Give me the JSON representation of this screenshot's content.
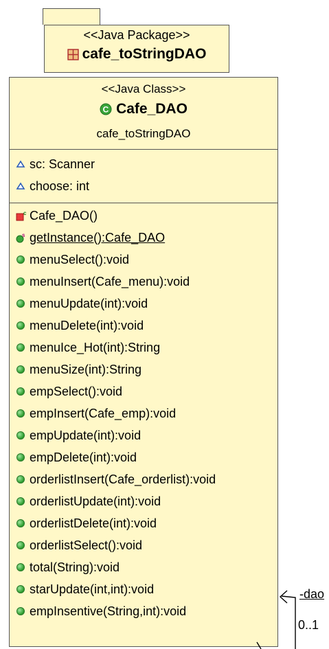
{
  "package": {
    "stereotype": "<<Java Package>>",
    "name": "cafe_toStringDAO",
    "icon": "package-icon"
  },
  "class": {
    "stereotype": "<<Java Class>>",
    "name": "Cafe_DAO",
    "package_label": "cafe_toStringDAO",
    "icon": "class-icon",
    "attributes": [
      {
        "text": "sc: Scanner",
        "icon": "package-visibility-icon"
      },
      {
        "text": "choose: int",
        "icon": "package-visibility-icon"
      }
    ],
    "operations": [
      {
        "text": "Cafe_DAO()",
        "icon": "constructor-icon"
      },
      {
        "text": "getInstance():Cafe_DAO",
        "icon": "static-method-icon"
      },
      {
        "text": "menuSelect():void",
        "icon": "public-method-icon"
      },
      {
        "text": "menuInsert(Cafe_menu):void",
        "icon": "public-method-icon"
      },
      {
        "text": "menuUpdate(int):void",
        "icon": "public-method-icon"
      },
      {
        "text": "menuDelete(int):void",
        "icon": "public-method-icon"
      },
      {
        "text": "menuIce_Hot(int):String",
        "icon": "public-method-icon"
      },
      {
        "text": "menuSize(int):String",
        "icon": "public-method-icon"
      },
      {
        "text": "empSelect():void",
        "icon": "public-method-icon"
      },
      {
        "text": "empInsert(Cafe_emp):void",
        "icon": "public-method-icon"
      },
      {
        "text": "empUpdate(int):void",
        "icon": "public-method-icon"
      },
      {
        "text": "empDelete(int):void",
        "icon": "public-method-icon"
      },
      {
        "text": "orderlistInsert(Cafe_orderlist):void",
        "icon": "public-method-icon"
      },
      {
        "text": "orderlistUpdate(int):void",
        "icon": "public-method-icon"
      },
      {
        "text": "orderlistDelete(int):void",
        "icon": "public-method-icon"
      },
      {
        "text": "orderlistSelect():void",
        "icon": "public-method-icon"
      },
      {
        "text": "total(String):void",
        "icon": "public-method-icon"
      },
      {
        "text": "starUpdate(int,int):void",
        "icon": "public-method-icon"
      },
      {
        "text": "empInsentive(String,int):void",
        "icon": "public-method-icon"
      }
    ]
  },
  "association": {
    "role": "-dao",
    "multiplicity": "0..1"
  },
  "colors": {
    "box_fill": "#fff8c8",
    "border": "#555555",
    "method_green": "#2a9a2a",
    "package_red": "#b03030"
  }
}
